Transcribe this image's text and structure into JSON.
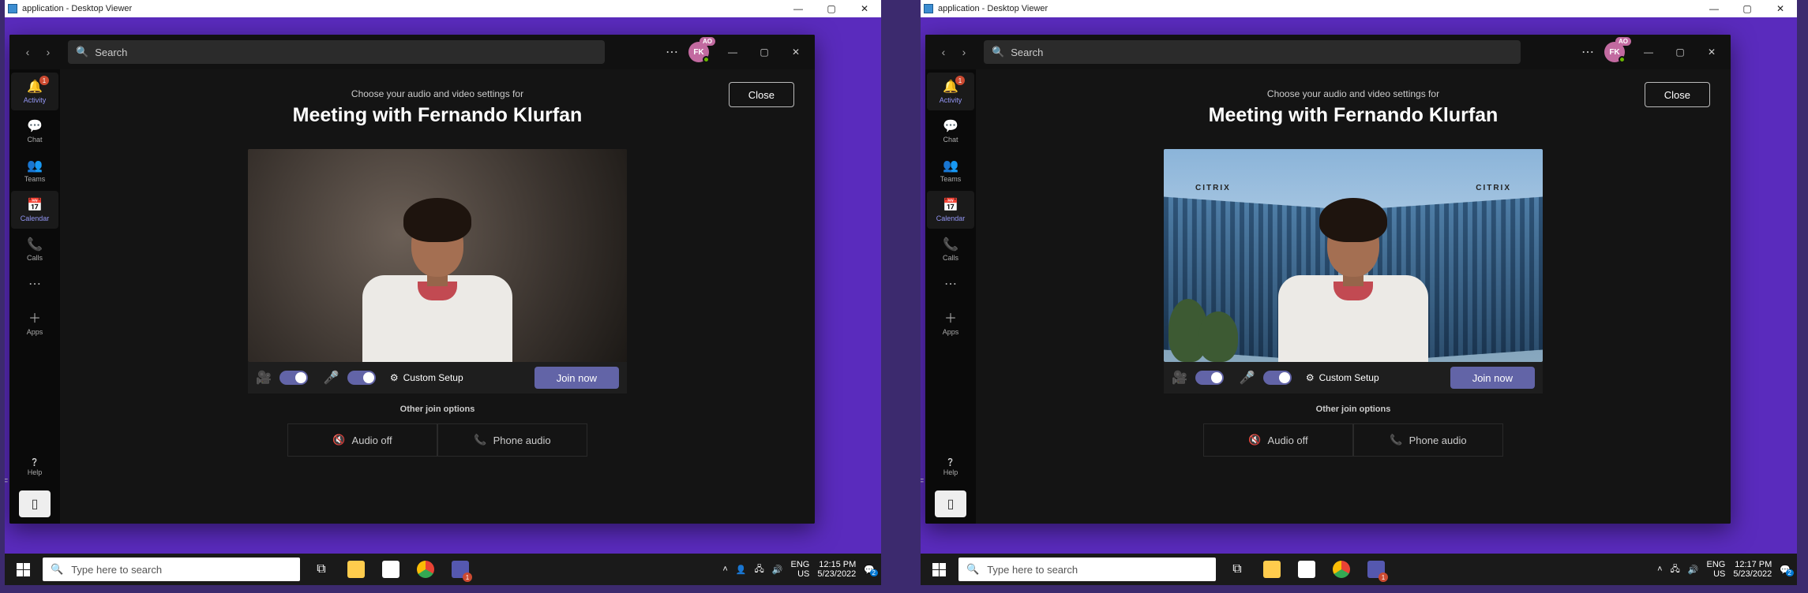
{
  "left": {
    "dv": {
      "title": "application - Desktop Viewer"
    },
    "teams": {
      "search_placeholder": "Search",
      "avatar_initials": "FK",
      "avatar_badge": "AO",
      "close_label": "Close",
      "prompt": "Choose your audio and video settings for",
      "meeting_title": "Meeting with Fernando Klurfan",
      "custom_label": "Custom Setup",
      "join_label": "Join now",
      "other_label": "Other join options",
      "audio_off_label": "Audio off",
      "phone_audio_label": "Phone audio",
      "sidebar": [
        {
          "label": "Activity",
          "icon": "🔔",
          "badge": "1"
        },
        {
          "label": "Chat",
          "icon": "💬"
        },
        {
          "label": "Teams",
          "icon": "👥"
        },
        {
          "label": "Calendar",
          "icon": "📅",
          "active": true
        },
        {
          "label": "Calls",
          "icon": "📞"
        }
      ],
      "apps_label": "Apps",
      "help_label": "Help"
    },
    "taskbar": {
      "search_placeholder": "Type here to search",
      "lang_top": "ENG",
      "lang_bottom": "US",
      "time": "12:15 PM",
      "date": "5/23/2022",
      "tray_badge": "2",
      "teams_badge": "1"
    },
    "edge_letter": "F"
  },
  "right": {
    "dv": {
      "title": "application - Desktop Viewer"
    },
    "teams": {
      "search_placeholder": "Search",
      "avatar_initials": "FK",
      "avatar_badge": "AO",
      "close_label": "Close",
      "prompt": "Choose your audio and video settings for",
      "meeting_title": "Meeting with Fernando Klurfan",
      "custom_label": "Custom Setup",
      "join_label": "Join now",
      "other_label": "Other join options",
      "audio_off_label": "Audio off",
      "phone_audio_label": "Phone audio",
      "building_label": "CITRIX",
      "sidebar": [
        {
          "label": "Activity",
          "icon": "🔔",
          "badge": "1"
        },
        {
          "label": "Chat",
          "icon": "💬"
        },
        {
          "label": "Teams",
          "icon": "👥"
        },
        {
          "label": "Calendar",
          "icon": "📅",
          "active": true
        },
        {
          "label": "Calls",
          "icon": "📞"
        }
      ],
      "apps_label": "Apps",
      "help_label": "Help"
    },
    "taskbar": {
      "search_placeholder": "Type here to search",
      "lang_top": "ENG",
      "lang_bottom": "US",
      "time": "12:17 PM",
      "date": "5/23/2022",
      "tray_badge": "2",
      "teams_badge": "1"
    },
    "edge_letter": "F"
  }
}
